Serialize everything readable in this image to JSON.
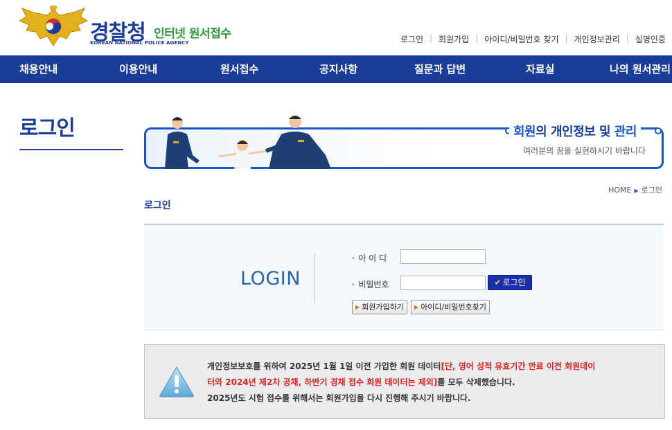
{
  "header": {
    "brand_ko": "경찰청",
    "brand_sub": "인터넷 원서접수",
    "brand_en": "KOREAN NATIONAL POLICE AGENCY",
    "util_links": [
      "로그인",
      "회원가입",
      "아이디/비밀번호 찾기",
      "개인정보관리",
      "실명인증"
    ]
  },
  "nav": {
    "items": [
      "채용안내",
      "이용안내",
      "원서접수",
      "공지사항",
      "질문과 답변",
      "자료실",
      "나의 원서관리"
    ]
  },
  "sidebar": {
    "title": "로그인"
  },
  "banner": {
    "head_1": "회원",
    "head_2": "의 ",
    "head_3": "개인정보",
    "head_4": " 및 ",
    "head_5": "관리",
    "sub": "여러분의 꿈을 실현하시기 바랍니다"
  },
  "breadcrumb": {
    "home": "HOME",
    "current": "로그인"
  },
  "page_title": "로그인",
  "login": {
    "heading": "LOGIN",
    "id_label": "아 이 디",
    "pw_label": "비밀번호",
    "id_value": "",
    "pw_value": "",
    "submit_label": "로그인",
    "join_label": "회원가입하기",
    "find_label": "아이디/비밀번호찾기"
  },
  "notice": {
    "line1_a": "개인정보보호를 위하여 2025년 1월 1일 이전 가입한 회원 데이터",
    "line1_b": "[단, 영어 성적 유효기간 만료 이전 회원데이",
    "line2_a": "터와 2024년 제2차 공채, 하반기 경채 접수 회원 데이터는 제외]",
    "line2_b": "를 모두 삭제했습니다.",
    "line3": "2025년도 시험 접수를 위해서는 회원가입을 다시 진행해 주시기 바랍니다."
  },
  "colors": {
    "primary": "#1a3d9a",
    "accent": "#1a55c8",
    "green": "#2b9b3a",
    "warning_red": "#dd2222"
  }
}
